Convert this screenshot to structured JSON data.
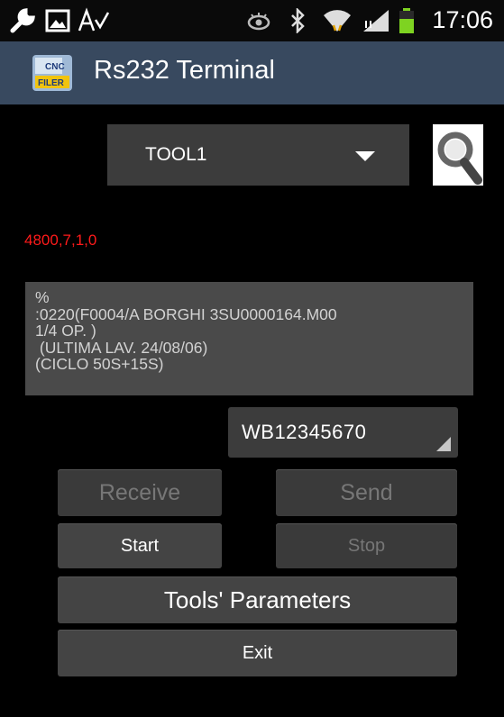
{
  "status_bar": {
    "time": "17:06",
    "icons": [
      "wrench-icon",
      "image-icon",
      "spellcheck-icon",
      "eye-icon",
      "bluetooth-icon",
      "wifi-icon",
      "signal-icon",
      "battery-icon"
    ]
  },
  "app_bar": {
    "title": "Rs232 Terminal",
    "icon_text": [
      "CNC",
      "FILER"
    ]
  },
  "tool_spinner": {
    "value": "TOOL1"
  },
  "response_text": "4800,7,1,0",
  "program_text": [
    "%",
    ":0220(F0004/A BORGHI 3SU0000164.M00",
    "1/4 OP. )",
    " (ULTIMA LAV. 24/08/06)",
    "(CICLO 50S+15S)"
  ],
  "machine_spinner": {
    "value": "WB12345670"
  },
  "buttons": {
    "receive": "Receive",
    "send": "Send",
    "start": "Start",
    "stop": "Stop",
    "tools_parameters": "Tools' Parameters",
    "exit": "Exit"
  },
  "colors": {
    "action_bar": "#38495f",
    "response": "#ff1a1a",
    "button": "#444444",
    "battery": "#7ed321"
  }
}
